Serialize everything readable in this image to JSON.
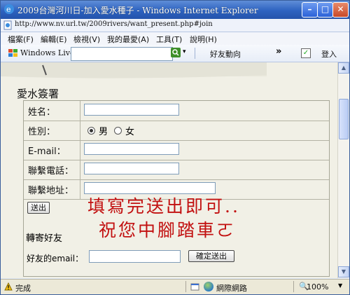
{
  "window": {
    "title": "2009台灣河川日-加入愛水種子 - Windows Internet Explorer",
    "minimize_symbol": "–",
    "maximize_symbol": "□",
    "close_symbol": "✕"
  },
  "address": {
    "url": "http://www.nv.url.tw/2009rivers/want_present.php#join"
  },
  "menu": {
    "items": [
      "檔案(F)",
      "編輯(E)",
      "檢視(V)",
      "我的最愛(A)",
      "工具(T)",
      "說明(H)"
    ]
  },
  "live_toolbar": {
    "brand": "Windows Live",
    "search_value": "",
    "go_arrow": "▾",
    "friends": "好友動向",
    "more": "»",
    "check": "✓",
    "login": "登入"
  },
  "page": {
    "section_title": "愛水簽署",
    "form": {
      "name_label": "姓名：",
      "name_value": "",
      "gender_label": "性別：",
      "gender_options": [
        "男",
        "女"
      ],
      "gender_selected": "男",
      "email_label": "E-mail：",
      "email_value": "",
      "phone_label": "聯繫電話：",
      "phone_value": "",
      "address_label": "聯繫地址：",
      "address_value": "",
      "submit_label": "送出"
    },
    "overlay_line1": "填寫完送出即可..",
    "overlay_line2": "祝您中腳踏車ㄛ",
    "forward": {
      "title": "轉寄好友",
      "email_label": "好友的email：",
      "email_value": "",
      "submit_label": "確定送出"
    }
  },
  "scrollbar": {
    "up_symbol": "▲",
    "down_symbol": "▼"
  },
  "status": {
    "text": "完成",
    "zone": "網際網路",
    "zoom": "100%",
    "zoom_symbol": "🔍",
    "zoom_arrow": "▼"
  },
  "colors": {
    "overlay_text": "#c21010",
    "content_bg": "#f1f0e6",
    "titlebar": "#2d62c0"
  }
}
